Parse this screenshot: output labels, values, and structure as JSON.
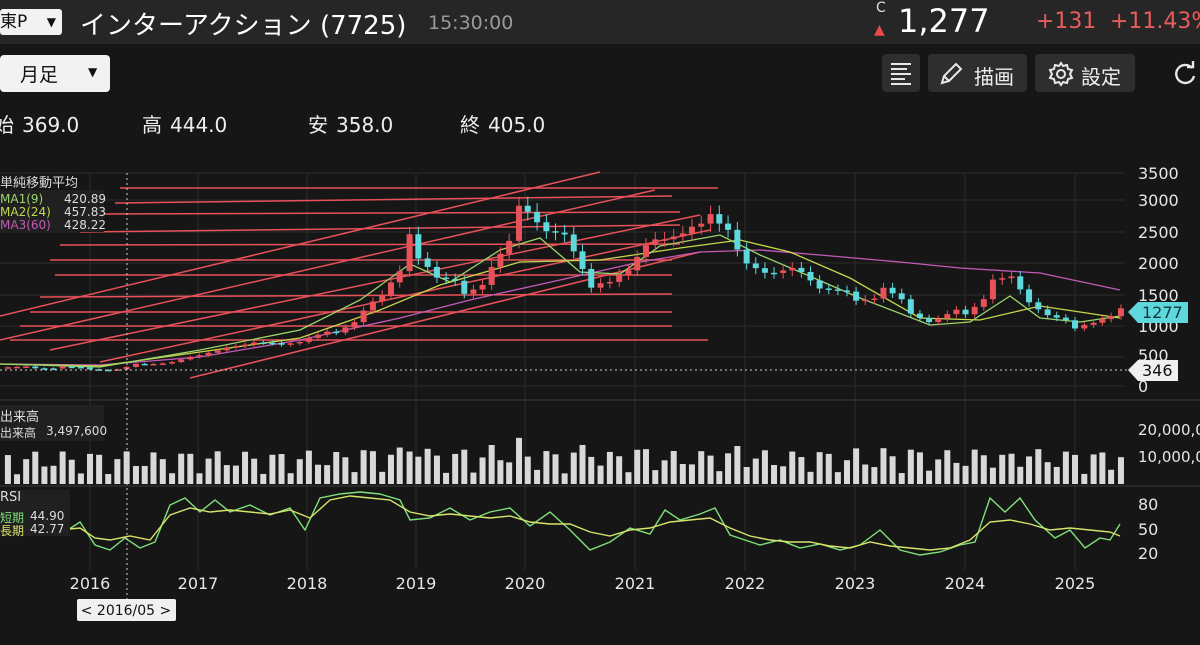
{
  "header": {
    "market_label": "東P",
    "stock_name": "インターアクション",
    "stock_code": "(7725)",
    "time": "15:30:00",
    "c_mark": "C",
    "price": "1,277",
    "change": "+131",
    "change_pct": "+11.43%"
  },
  "toolbar": {
    "period_label": "月足",
    "draw_label": "描画",
    "settings_label": "設定"
  },
  "ohlc": {
    "open_key": "始",
    "open_val": "369.0",
    "high_key": "高",
    "high_val": "444.0",
    "low_key": "安",
    "low_val": "358.0",
    "close_key": "終",
    "close_val": "405.0"
  },
  "ma_legend": {
    "title": "単純移動平均",
    "ma1_label": "MA1(9)",
    "ma1_value": "420.89",
    "ma2_label": "MA2(24)",
    "ma2_value": "457.83",
    "ma3_label": "MA3(60)",
    "ma3_value": "428.22"
  },
  "volume_legend": {
    "title": "出来高",
    "label": "出来高",
    "value": "3,497,600"
  },
  "rsi_legend": {
    "title": "RSI",
    "short_label": "短期",
    "short_value": "44.90",
    "long_label": "長期",
    "long_value": "42.77"
  },
  "price_axis": [
    "3500",
    "3000",
    "2500",
    "2000",
    "1500",
    "1000",
    "500",
    "0"
  ],
  "price_badge": "1277",
  "cursor_price_badge": "346",
  "volume_axis": [
    "20,000,000",
    "10,000,000"
  ],
  "rsi_axis": [
    "80",
    "50",
    "20"
  ],
  "x_axis": [
    "2016",
    "2017",
    "2018",
    "2019",
    "2020",
    "2021",
    "2022",
    "2023",
    "2024",
    "2025"
  ],
  "cursor_date": "< 2016/05 >",
  "colors": {
    "up": "#e8515a",
    "down": "#5ed8dc",
    "ma1": "#9ad66a",
    "ma2": "#c6d84a",
    "ma3": "#c45ab8",
    "rsi_short": "#7fe07a",
    "rsi_long": "#d8e46a",
    "trendline": "#e8515a"
  },
  "chart_data": {
    "type": "candlestick",
    "interval": "monthly",
    "ylim": [
      0,
      3500
    ],
    "series": [
      {
        "name": "price",
        "values_t_close": [
          [
            2015.25,
            290
          ],
          [
            2015.5,
            310
          ],
          [
            2015.75,
            300
          ],
          [
            2016.0,
            290
          ],
          [
            2016.25,
            260
          ],
          [
            2016.42,
            346
          ],
          [
            2016.58,
            350
          ],
          [
            2016.75,
            380
          ],
          [
            2017.0,
            520
          ],
          [
            2017.25,
            620
          ],
          [
            2017.5,
            720
          ],
          [
            2017.75,
            680
          ],
          [
            2018.0,
            780
          ],
          [
            2018.25,
            900
          ],
          [
            2018.5,
            1200
          ],
          [
            2018.67,
            1450
          ],
          [
            2018.83,
            1800
          ],
          [
            2018.92,
            2600
          ],
          [
            2019.0,
            2000
          ],
          [
            2019.17,
            1700
          ],
          [
            2019.42,
            1600
          ],
          [
            2019.67,
            1850
          ],
          [
            2019.83,
            2250
          ],
          [
            2019.92,
            3150
          ],
          [
            2020.0,
            2700
          ],
          [
            2020.17,
            2400
          ],
          [
            2020.42,
            2350
          ],
          [
            2020.58,
            1700
          ],
          [
            2020.75,
            1800
          ],
          [
            2020.92,
            2000
          ],
          [
            2021.08,
            2400
          ],
          [
            2021.25,
            2500
          ],
          [
            2021.5,
            2550
          ],
          [
            2021.67,
            2750
          ],
          [
            2021.83,
            2550
          ],
          [
            2022.0,
            2000
          ],
          [
            2022.25,
            1850
          ],
          [
            2022.5,
            1900
          ],
          [
            2022.75,
            1550
          ],
          [
            2023.0,
            1450
          ],
          [
            2023.25,
            1550
          ],
          [
            2023.5,
            1250
          ],
          [
            2023.75,
            1050
          ],
          [
            2024.0,
            1250
          ],
          [
            2024.25,
            1650
          ],
          [
            2024.42,
            1700
          ],
          [
            2024.58,
            1300
          ],
          [
            2024.75,
            1100
          ],
          [
            2025.0,
            1000
          ],
          [
            2025.17,
            1100
          ],
          [
            2025.33,
            1200
          ],
          [
            2025.42,
            1277
          ]
        ]
      }
    ],
    "volume_axis_labels": [
      "20,000,000",
      "10,000,000"
    ],
    "rsi_levels": [
      80,
      50,
      20
    ]
  }
}
